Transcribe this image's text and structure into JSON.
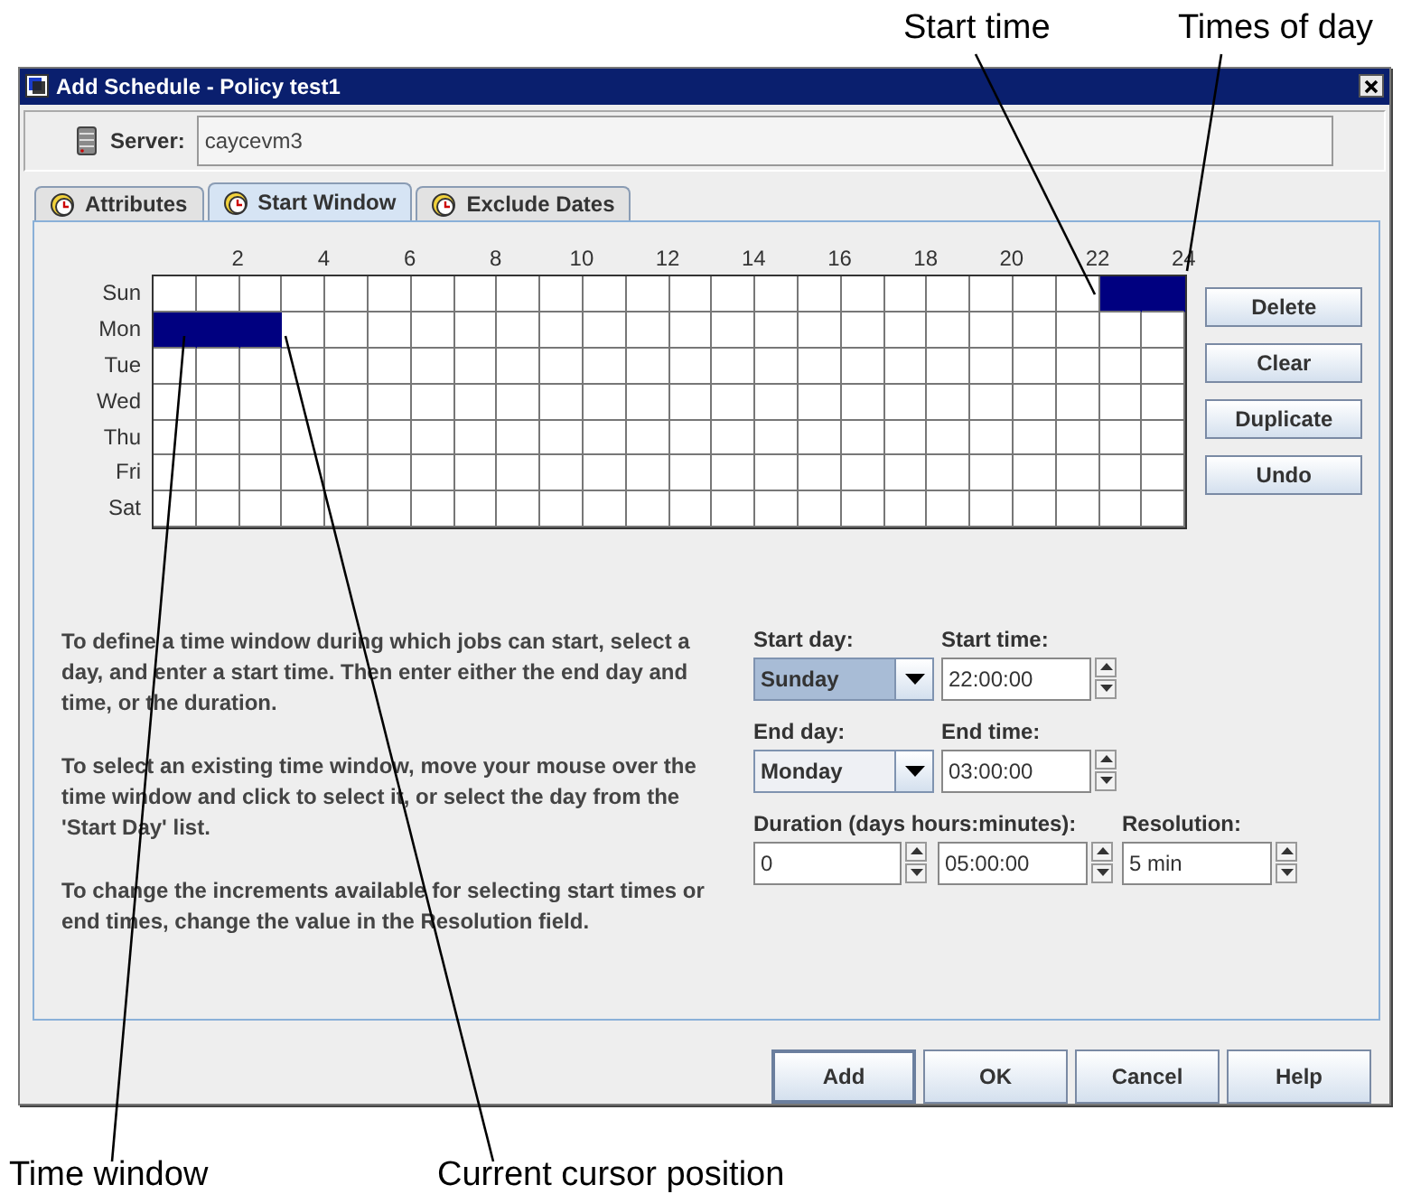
{
  "callouts": [
    {
      "label": "Start time"
    },
    {
      "label": "Times of day"
    },
    {
      "label": "Time window"
    },
    {
      "label": "Current cursor position"
    }
  ],
  "window": {
    "title": "Add Schedule - Policy test1"
  },
  "server": {
    "label": "Server:",
    "value": "caycevm3"
  },
  "tabs": [
    {
      "label": "Attributes",
      "selected": false
    },
    {
      "label": "Start Window",
      "selected": true
    },
    {
      "label": "Exclude Dates",
      "selected": false
    }
  ],
  "schedule_grid": {
    "hour_labels": [
      "2",
      "4",
      "6",
      "8",
      "10",
      "12",
      "14",
      "16",
      "18",
      "20",
      "22",
      "24"
    ],
    "days": [
      {
        "label": "Sun",
        "slots": [
          {
            "selected": false
          },
          {
            "selected": false
          },
          {
            "selected": false
          },
          {
            "selected": false
          },
          {
            "selected": false
          },
          {
            "selected": false
          },
          {
            "selected": false
          },
          {
            "selected": false
          },
          {
            "selected": false
          },
          {
            "selected": false
          },
          {
            "selected": false
          },
          {
            "selected": false
          },
          {
            "selected": false
          },
          {
            "selected": false
          },
          {
            "selected": false
          },
          {
            "selected": false
          },
          {
            "selected": false
          },
          {
            "selected": false
          },
          {
            "selected": false
          },
          {
            "selected": false
          },
          {
            "selected": false
          },
          {
            "selected": false
          },
          {
            "selected": true
          },
          {
            "selected": true
          }
        ]
      },
      {
        "label": "Mon",
        "slots": [
          {
            "selected": true
          },
          {
            "selected": true
          },
          {
            "selected": true
          },
          {
            "selected": false
          },
          {
            "selected": false
          },
          {
            "selected": false
          },
          {
            "selected": false
          },
          {
            "selected": false
          },
          {
            "selected": false
          },
          {
            "selected": false
          },
          {
            "selected": false
          },
          {
            "selected": false
          },
          {
            "selected": false
          },
          {
            "selected": false
          },
          {
            "selected": false
          },
          {
            "selected": false
          },
          {
            "selected": false
          },
          {
            "selected": false
          },
          {
            "selected": false
          },
          {
            "selected": false
          },
          {
            "selected": false
          },
          {
            "selected": false
          },
          {
            "selected": false
          },
          {
            "selected": false
          }
        ]
      },
      {
        "label": "Tue",
        "slots": [
          {
            "selected": false
          },
          {
            "selected": false
          },
          {
            "selected": false
          },
          {
            "selected": false
          },
          {
            "selected": false
          },
          {
            "selected": false
          },
          {
            "selected": false
          },
          {
            "selected": false
          },
          {
            "selected": false
          },
          {
            "selected": false
          },
          {
            "selected": false
          },
          {
            "selected": false
          },
          {
            "selected": false
          },
          {
            "selected": false
          },
          {
            "selected": false
          },
          {
            "selected": false
          },
          {
            "selected": false
          },
          {
            "selected": false
          },
          {
            "selected": false
          },
          {
            "selected": false
          },
          {
            "selected": false
          },
          {
            "selected": false
          },
          {
            "selected": false
          },
          {
            "selected": false
          }
        ]
      },
      {
        "label": "Wed",
        "slots": [
          {
            "selected": false
          },
          {
            "selected": false
          },
          {
            "selected": false
          },
          {
            "selected": false
          },
          {
            "selected": false
          },
          {
            "selected": false
          },
          {
            "selected": false
          },
          {
            "selected": false
          },
          {
            "selected": false
          },
          {
            "selected": false
          },
          {
            "selected": false
          },
          {
            "selected": false
          },
          {
            "selected": false
          },
          {
            "selected": false
          },
          {
            "selected": false
          },
          {
            "selected": false
          },
          {
            "selected": false
          },
          {
            "selected": false
          },
          {
            "selected": false
          },
          {
            "selected": false
          },
          {
            "selected": false
          },
          {
            "selected": false
          },
          {
            "selected": false
          },
          {
            "selected": false
          }
        ]
      },
      {
        "label": "Thu",
        "slots": [
          {
            "selected": false
          },
          {
            "selected": false
          },
          {
            "selected": false
          },
          {
            "selected": false
          },
          {
            "selected": false
          },
          {
            "selected": false
          },
          {
            "selected": false
          },
          {
            "selected": false
          },
          {
            "selected": false
          },
          {
            "selected": false
          },
          {
            "selected": false
          },
          {
            "selected": false
          },
          {
            "selected": false
          },
          {
            "selected": false
          },
          {
            "selected": false
          },
          {
            "selected": false
          },
          {
            "selected": false
          },
          {
            "selected": false
          },
          {
            "selected": false
          },
          {
            "selected": false
          },
          {
            "selected": false
          },
          {
            "selected": false
          },
          {
            "selected": false
          },
          {
            "selected": false
          }
        ]
      },
      {
        "label": "Fri",
        "slots": [
          {
            "selected": false
          },
          {
            "selected": false
          },
          {
            "selected": false
          },
          {
            "selected": false
          },
          {
            "selected": false
          },
          {
            "selected": false
          },
          {
            "selected": false
          },
          {
            "selected": false
          },
          {
            "selected": false
          },
          {
            "selected": false
          },
          {
            "selected": false
          },
          {
            "selected": false
          },
          {
            "selected": false
          },
          {
            "selected": false
          },
          {
            "selected": false
          },
          {
            "selected": false
          },
          {
            "selected": false
          },
          {
            "selected": false
          },
          {
            "selected": false
          },
          {
            "selected": false
          },
          {
            "selected": false
          },
          {
            "selected": false
          },
          {
            "selected": false
          },
          {
            "selected": false
          }
        ]
      },
      {
        "label": "Sat",
        "slots": [
          {
            "selected": false
          },
          {
            "selected": false
          },
          {
            "selected": false
          },
          {
            "selected": false
          },
          {
            "selected": false
          },
          {
            "selected": false
          },
          {
            "selected": false
          },
          {
            "selected": false
          },
          {
            "selected": false
          },
          {
            "selected": false
          },
          {
            "selected": false
          },
          {
            "selected": false
          },
          {
            "selected": false
          },
          {
            "selected": false
          },
          {
            "selected": false
          },
          {
            "selected": false
          },
          {
            "selected": false
          },
          {
            "selected": false
          },
          {
            "selected": false
          },
          {
            "selected": false
          },
          {
            "selected": false
          },
          {
            "selected": false
          },
          {
            "selected": false
          },
          {
            "selected": false
          }
        ]
      }
    ]
  },
  "side_buttons": [
    {
      "label": "Delete"
    },
    {
      "label": "Clear"
    },
    {
      "label": "Duplicate"
    },
    {
      "label": "Undo"
    }
  ],
  "instructions": [
    "To define a time window during which jobs can start, select a day, and enter a start time. Then enter either the end day and time, or the duration.",
    "To select an existing time window, move your mouse over the time window and click to select it, or select the day from the 'Start Day' list.",
    "To change the increments available for selecting start times or end times, change the value in the Resolution field."
  ],
  "form": {
    "start_day": {
      "label": "Start day:",
      "value": "Sunday",
      "focused": true
    },
    "start_time": {
      "label": "Start time:",
      "value": "22:00:00"
    },
    "end_day": {
      "label": "End day:",
      "value": "Monday",
      "focused": false
    },
    "end_time": {
      "label": "End time:",
      "value": "03:00:00"
    },
    "duration": {
      "label": "Duration (days hours:minutes):",
      "days": "0",
      "time": "05:00:00"
    },
    "resolution": {
      "label": "Resolution:",
      "value": "5 min"
    }
  },
  "buttons": [
    {
      "label": "Add",
      "default": true
    },
    {
      "label": "OK",
      "default": false
    },
    {
      "label": "Cancel",
      "default": false
    },
    {
      "label": "Help",
      "default": false
    }
  ]
}
